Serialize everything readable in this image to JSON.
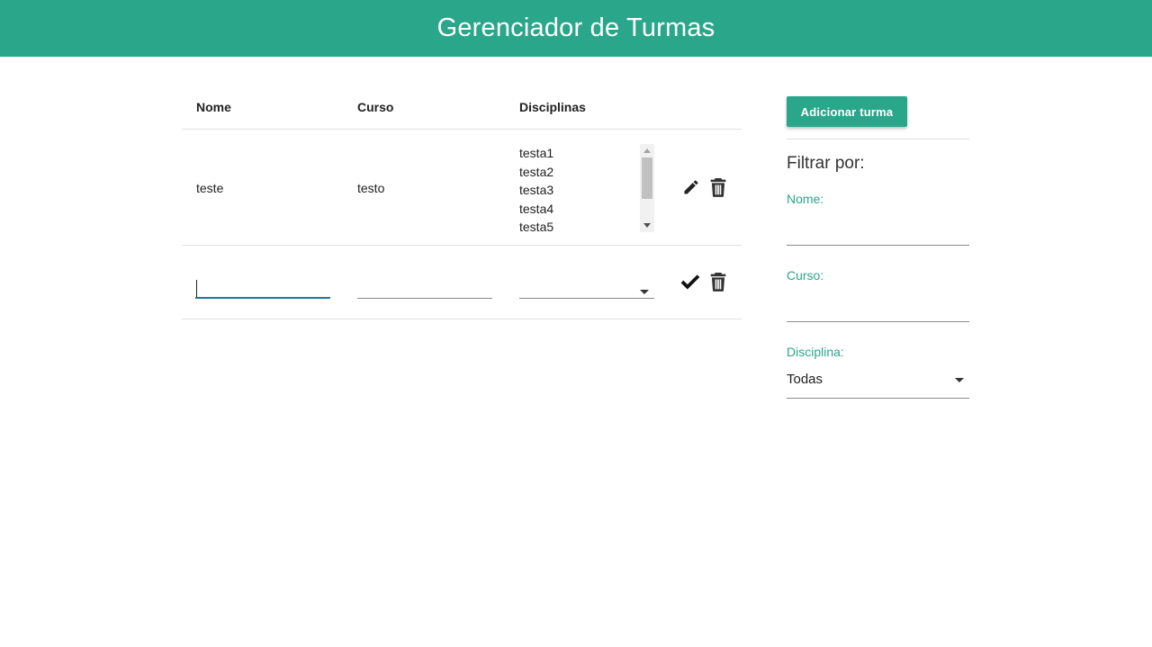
{
  "header": {
    "title": "Gerenciador de Turmas"
  },
  "table": {
    "columns": {
      "nome": "Nome",
      "curso": "Curso",
      "disciplinas": "Disciplinas"
    },
    "rows": [
      {
        "nome": "teste",
        "curso": "testo",
        "disciplinas": [
          "testa1",
          "testa2",
          "testa3",
          "testa4",
          "testa5"
        ],
        "actions": [
          "edit-icon",
          "delete-icon"
        ]
      }
    ],
    "new_row": {
      "nome_value": "",
      "curso_value": "",
      "disciplinas_value": "",
      "actions": [
        "check-icon",
        "delete-icon"
      ]
    }
  },
  "sidebar": {
    "add_button_label": "Adicionar turma",
    "filter_title": "Filtrar por:",
    "filters": {
      "nome_label": "Nome:",
      "nome_value": "",
      "curso_label": "Curso:",
      "curso_value": "",
      "disciplina_label": "Disciplina:",
      "disciplina_value": "Todas"
    }
  },
  "colors": {
    "brand": "#2aa68a",
    "focus_underline": "#1f7a9a"
  }
}
